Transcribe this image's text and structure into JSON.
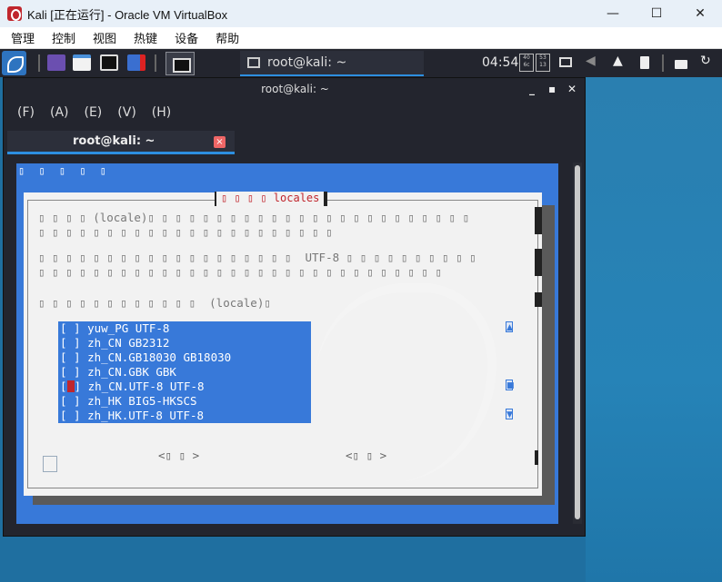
{
  "host": {
    "title": "Kali [正在运行] - Oracle VM VirtualBox",
    "menu": [
      "管理",
      "控制",
      "视图",
      "热键",
      "设备",
      "帮助"
    ]
  },
  "panel": {
    "active_task": "root@kali: ~",
    "clock": "04:54"
  },
  "terminal": {
    "title": "root@kali: ~",
    "menu": [
      "(F)",
      "(A)",
      "(E)",
      "(V)",
      "(H)"
    ],
    "tab_label": "root@kali: ~",
    "tab_close": "×"
  },
  "tui": {
    "backtitle": "▯ ▯ ▯ ▯ ▯",
    "dialog_title": "▯ ▯ ▯ ▯  locales",
    "desc_lines": [
      "▯ ▯ ▯ ▯ (locale)▯ ▯ ▯ ▯ ▯ ▯ ▯ ▯ ▯ ▯ ▯ ▯ ▯ ▯ ▯ ▯ ▯ ▯ ▯ ▯ ▯ ▯ ▯ ▯",
      "▯ ▯ ▯ ▯ ▯ ▯ ▯ ▯ ▯ ▯ ▯ ▯ ▯ ▯ ▯ ▯ ▯ ▯ ▯ ▯ ▯ ▯",
      "▯ ▯ ▯ ▯ ▯ ▯ ▯ ▯ ▯ ▯ ▯ ▯ ▯ ▯ ▯ ▯ ▯ ▯ ▯  UTF-8 ▯ ▯ ▯ ▯ ▯ ▯ ▯ ▯ ▯ ▯",
      "▯ ▯ ▯ ▯ ▯ ▯ ▯ ▯ ▯ ▯ ▯ ▯ ▯ ▯ ▯ ▯ ▯ ▯ ▯ ▯ ▯ ▯ ▯ ▯ ▯ ▯ ▯ ▯ ▯ ▯",
      "▯ ▯ ▯ ▯ ▯ ▯ ▯ ▯ ▯ ▯ ▯ ▯  (locale)▯"
    ],
    "locales": [
      {
        "check": "[ ]",
        "label": "yuw_PG UTF-8"
      },
      {
        "check": "[ ]",
        "label": "zh_CN GB2312"
      },
      {
        "check": "[ ]",
        "label": "zh_CN.GB18030 GB18030"
      },
      {
        "check": "[ ]",
        "label": "zh_CN.GBK GBK"
      },
      {
        "check": "[*]",
        "label": "zh_CN.UTF-8 UTF-8"
      },
      {
        "check": "[ ]",
        "label": "zh_HK BIG5-HKSCS"
      },
      {
        "check": "[ ]",
        "label": "zh_HK.UTF-8 UTF-8"
      }
    ],
    "ok_button": "<▯ ▯ >",
    "cancel_button": "<▯ ▯ >"
  },
  "colors": {
    "tui_blue": "#3879d9",
    "accent_red": "#c0262d",
    "panel_bg": "#23252e"
  }
}
